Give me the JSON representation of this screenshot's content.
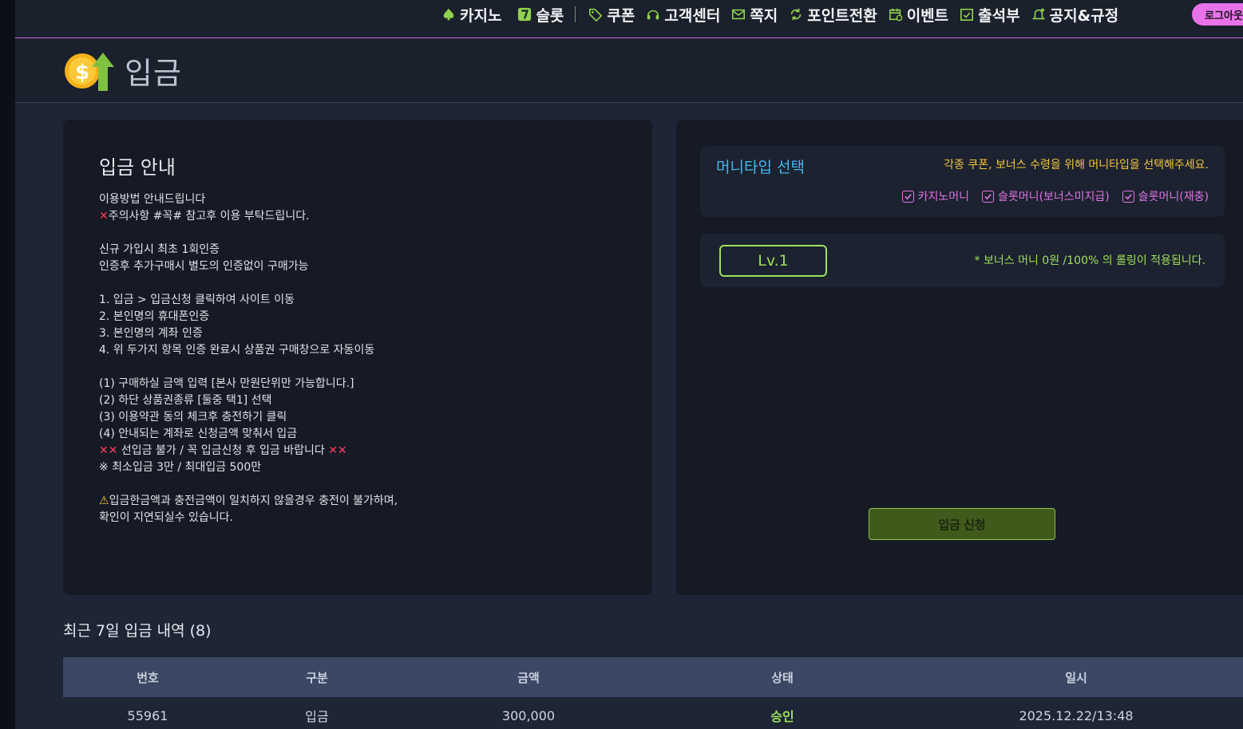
{
  "nav": {
    "items": [
      {
        "label": "카지노",
        "icon": "spade-icon"
      },
      {
        "label": "슬롯",
        "icon": "slot-seven-icon"
      },
      {
        "label": "쿠폰",
        "icon": "tag-icon"
      },
      {
        "label": "고객센터",
        "icon": "headset-icon"
      },
      {
        "label": "쪽지",
        "icon": "mail-icon"
      },
      {
        "label": "포인트전환",
        "icon": "refresh-icon"
      },
      {
        "label": "이벤트",
        "icon": "calendar-icon"
      },
      {
        "label": "출석부",
        "icon": "check-calendar-icon"
      },
      {
        "label": "공지&규정",
        "icon": "bell-icon"
      }
    ],
    "logout_label": "로그아웃"
  },
  "header": {
    "title": "입금",
    "icon": "deposit-coin-icon"
  },
  "guide": {
    "title": "입금 안내",
    "lines": [
      "이용방법 안내드립니다",
      "주의사항 #꼭# 참고후 이용 부탁드립니다.",
      "",
      "신규 가입시 최초 1회인증",
      "인증후 추가구매시 별도의 인증없이 구매가능",
      "",
      "1. 입금 > 입금신청 클릭하여 사이트 이동",
      "2. 본인명의 휴대폰인증",
      "3. 본인명의 계좌 인증",
      "4. 위 두가지 항목 인증 완료시 상품권 구매창으로 자동이동",
      "",
      "(1) 구매하실 금액 입력 [본사 만원단위만 가능합니다.]",
      "(2) 하단 상품권종류 [둘중 택1] 선택",
      "(3) 이용약관 동의 체크후 충전하기 클릭",
      "(4) 안내되는 계좌로 신청금액 맞춰서 입금",
      "선입금 불가 / 꼭 입금신청 후 입금 바랍니다",
      "※ 최소입금 3만 / 최대입금 500만",
      "",
      "입금한금액과 충전금액이 일치하지 않을경우 충전이 불가하며,",
      "확인이 지연되실수 있습니다."
    ]
  },
  "money_type": {
    "title": "머니타입 선택",
    "hint": "각종 쿠폰, 보너스 수령을 위해 머니타입을 선택해주세요.",
    "options": [
      "카지노머니",
      "슬롯머니(보너스미지급)",
      "슬롯머니(재충)"
    ]
  },
  "level": {
    "badge": "Lv.1",
    "note": "* 보너스 머니 0원 /100% 의 롤링이 적용됩니다."
  },
  "deposit_button": "입금 신청",
  "history": {
    "title": "최근 7일 입금 내역 (8)",
    "columns": [
      "번호",
      "구분",
      "금액",
      "상태",
      "일시"
    ],
    "rows": [
      {
        "no": "55961",
        "type": "입금",
        "amount": "300,000",
        "status": "승인",
        "date": "2025.12.22/13:48"
      }
    ]
  },
  "colors": {
    "accent_pink": "#e374e6",
    "accent_green": "#9ee05a",
    "accent_blue": "#41b8f0",
    "accent_yellow": "#f3c63a",
    "alert_red": "#ff3b5a"
  }
}
